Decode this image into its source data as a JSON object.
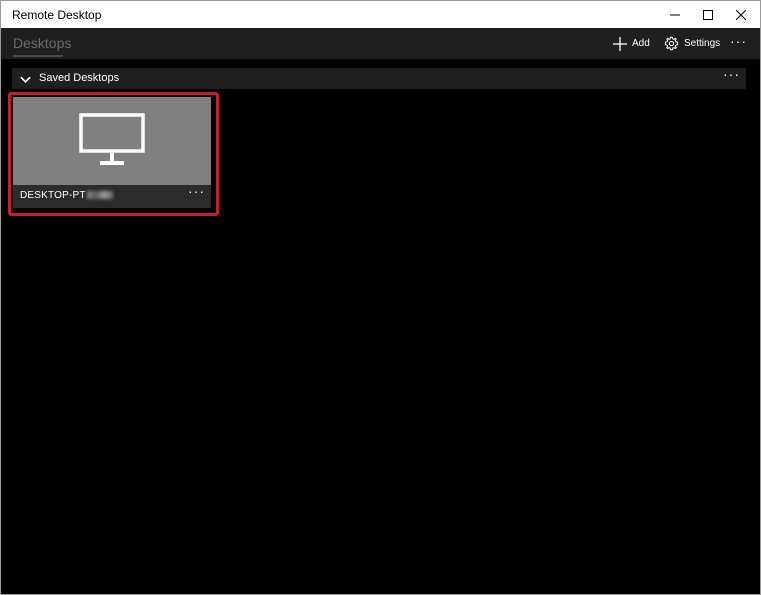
{
  "window": {
    "title": "Remote Desktop"
  },
  "appbar": {
    "tab_label": "Desktops",
    "add_label": "Add",
    "settings_label": "Settings",
    "more_label": "···"
  },
  "group": {
    "title": "Saved Desktops",
    "more_label": "···"
  },
  "desktops": [
    {
      "name": "DESKTOP-PT",
      "more_label": "···",
      "icon": "monitor-icon"
    }
  ],
  "colors": {
    "highlight": "#c0202a",
    "background": "#000000",
    "bar": "#1f1f1f"
  }
}
